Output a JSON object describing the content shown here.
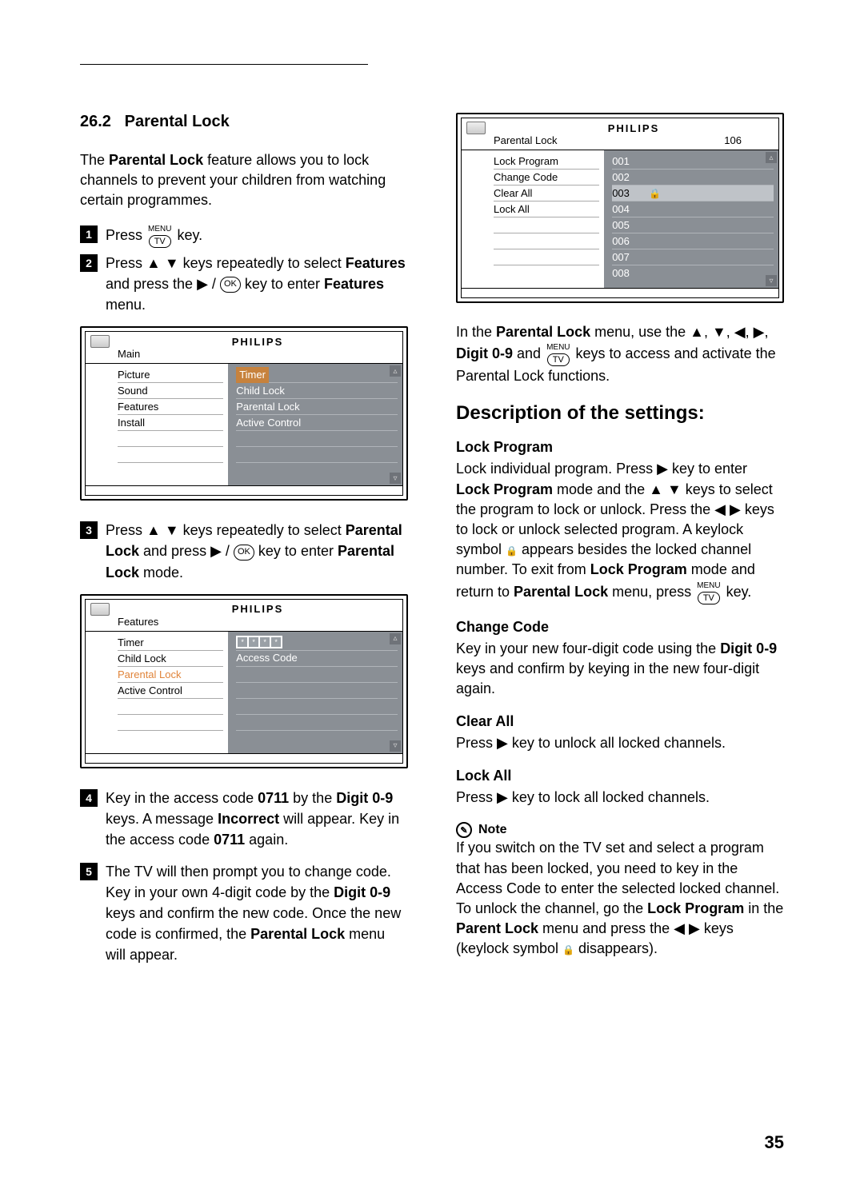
{
  "section": {
    "number": "26.2",
    "title": "Parental Lock"
  },
  "intro": {
    "pre": "The ",
    "feat": "Parental Lock",
    "post": " feature allows you to lock channels to prevent your children from watching certain programmes."
  },
  "steps": {
    "s1": {
      "a": "Press ",
      "b": " key."
    },
    "s2": {
      "a": "Press  ▲ ▼  keys repeatedly to select ",
      "feat": "Features",
      "b": " and press the  ▶ / ",
      "c": " key to enter ",
      "feat2": "Features",
      "d": " menu."
    },
    "s3": {
      "a": "Press  ▲ ▼ keys repeatedly to select ",
      "pl": "Parental Lock",
      "b": " and press ▶ / ",
      "c": " key to enter ",
      "plm": "Parental Lock",
      "d": " mode."
    },
    "s4": {
      "a": "Key in the access code ",
      "code": "0711",
      "b": " by the ",
      "d": "Digit 0-9",
      "c": " keys. A message ",
      "inc": "Incorrect",
      "e": " will appear. Key in the access code ",
      "code2": "0711",
      "f": " again."
    },
    "s5": {
      "a": "The TV will then prompt you to change code. Key in your own 4-digit code by the ",
      "d": "Digit 0-9",
      "b": " keys and confirm the new code. Once the new code is confirmed, the ",
      "pl": "Parental Lock",
      "c": " menu will appear."
    }
  },
  "menu_key": {
    "top": "MENU",
    "pill": "TV"
  },
  "ok_key": "OK",
  "right_intro": {
    "a": "In the ",
    "pl": "Parental Lock",
    "b": " menu, use the  ▲, ▼, ◀,  ▶, ",
    "d": "Digit 0-9",
    "c": " and ",
    "e": " keys to access and activate the Parental Lock functions."
  },
  "desc_head": "Description of the settings:",
  "lock_program": {
    "head": "Lock Program",
    "a": "Lock individual program. Press ▶ key to enter ",
    "lpm": "Lock Program",
    "b": " mode and the ▲ ▼ keys to select the program to lock or unlock. Press the ◀ ▶ keys to lock or unlock selected program. A keylock symbol ",
    "c": " appears besides the locked channel number.  To exit from ",
    "lpm2": "Lock Program",
    "d": " mode and return to ",
    "pl": "Parental Lock",
    "e": " menu, press ",
    "f": " key."
  },
  "change_code": {
    "head": "Change Code",
    "a": "Key in your new four-digit code using the ",
    "d": "Digit 0-9",
    "b": " keys and confirm by keying in the new four-digit again."
  },
  "clear_all": {
    "head": "Clear All",
    "a": "Press ▶ key to unlock all locked channels."
  },
  "lock_all": {
    "head": "Lock All",
    "a": "Press ▶ key to lock all locked channels."
  },
  "note": {
    "head": "Note",
    "a": "If you switch on the TV set and select a program that has been locked, you need to key in the Access Code to enter the selected locked channel. To unlock the channel, go the ",
    "lp": "Lock Program",
    "b": " in the ",
    "pl": "Parent Lock",
    "c": " menu and press the ◀ ▶ keys (keylock symbol ",
    "d": " disappears)."
  },
  "osd": {
    "brand": "PHILIPS",
    "main": {
      "title": "Main",
      "left": [
        "Picture",
        "Sound",
        "Features",
        "Install"
      ],
      "right": [
        "Timer",
        "Child Lock",
        "Parental Lock",
        "Active Control"
      ],
      "selected_right": "Timer"
    },
    "features": {
      "title": "Features",
      "left": [
        "Timer",
        "Child Lock",
        "Parental Lock",
        "Active Control"
      ],
      "right_first": "* * * *",
      "right_second": "Access Code",
      "highlight_left": "Parental Lock"
    },
    "pl": {
      "title": "Parental Lock",
      "channel": "106",
      "left": [
        "Lock Program",
        "Change Code",
        "Clear All",
        "Lock All"
      ],
      "right": [
        "001",
        "002",
        "003",
        "004",
        "005",
        "006",
        "007",
        "008"
      ],
      "locked_row": "003"
    }
  },
  "page_number": "35"
}
